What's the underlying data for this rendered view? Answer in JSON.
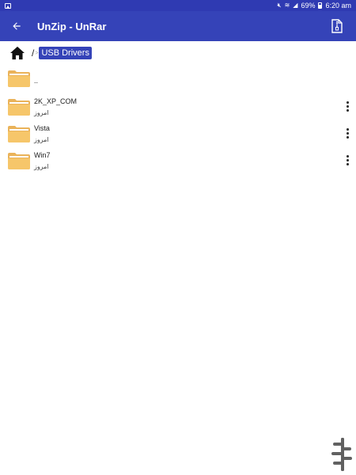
{
  "status_bar": {
    "battery": "69%",
    "time": "6:20 am"
  },
  "app_bar": {
    "title": "UnZip - UnRar"
  },
  "breadcrumb": {
    "separator": "/",
    "arrow": ">",
    "current": "USB Drivers"
  },
  "files": {
    "parent_label": "..",
    "items": [
      {
        "name": "2K_XP_COM",
        "date": "امروز"
      },
      {
        "name": "Vista",
        "date": "امروز"
      },
      {
        "name": "Win7",
        "date": "امروز"
      }
    ]
  },
  "colors": {
    "primary": "#3543b8",
    "folder": "#f6c66a",
    "folder_dark": "#eab35a"
  },
  "icons": [
    "back-arrow-icon",
    "zip-file-icon",
    "home-icon",
    "folder-icon",
    "more-vert-icon",
    "app-logo-icon"
  ]
}
